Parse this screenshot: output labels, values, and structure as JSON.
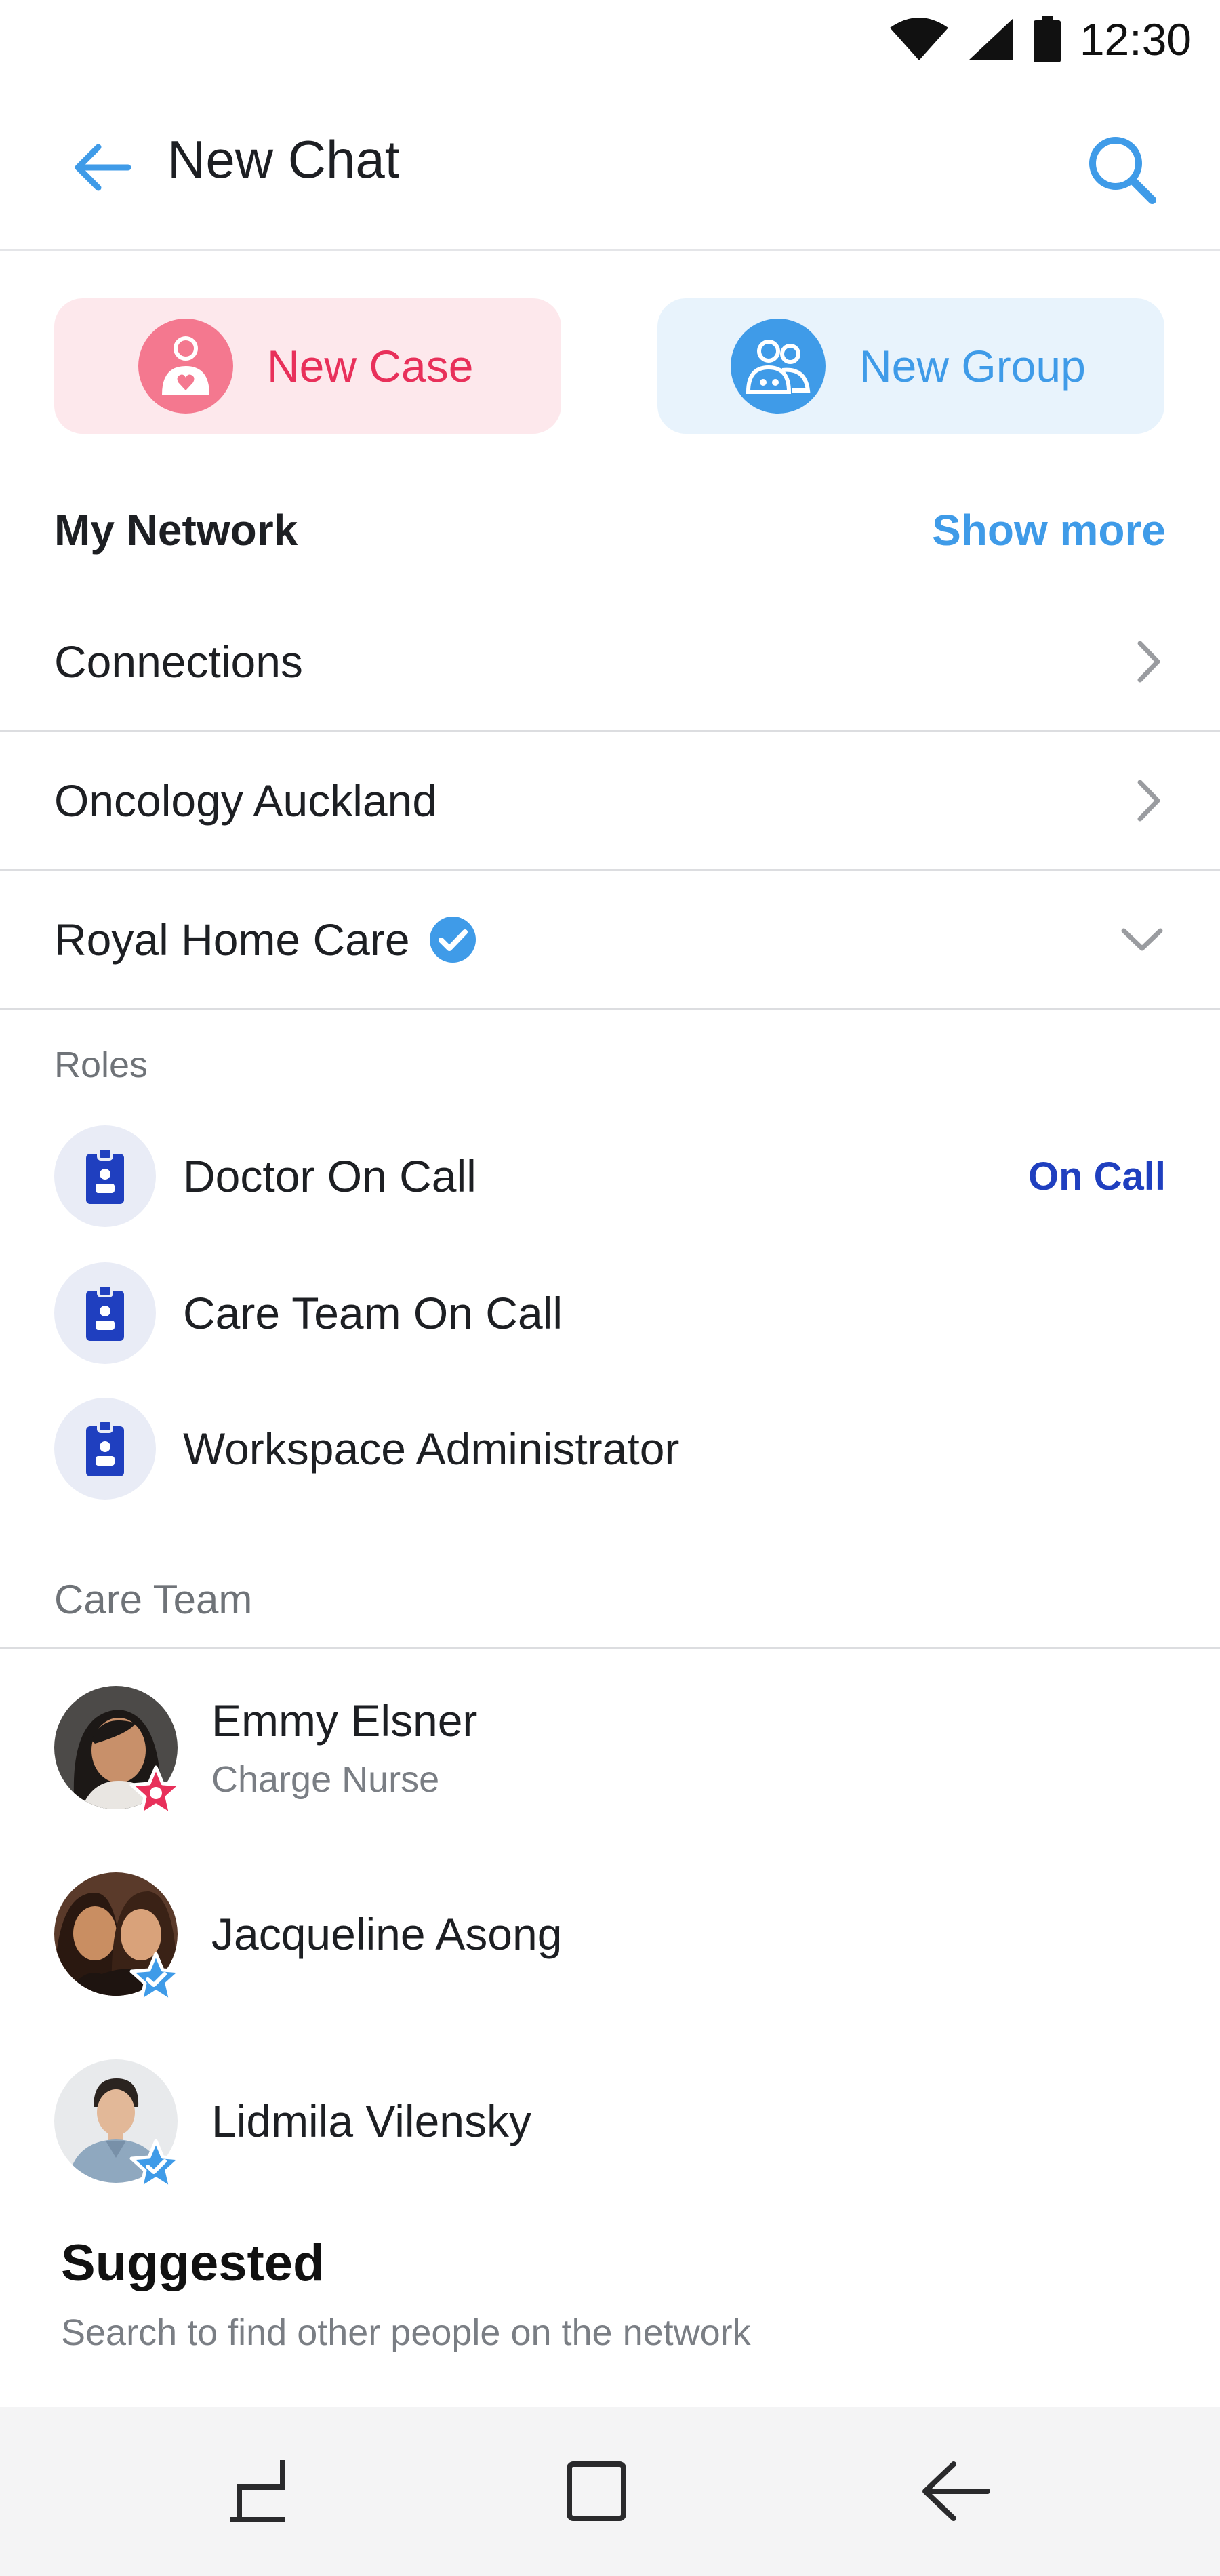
{
  "status_bar": {
    "time": "12:30"
  },
  "app_bar": {
    "title": "New Chat"
  },
  "actions": {
    "new_case": "New Case",
    "new_group": "New Group"
  },
  "my_network": {
    "title": "My Network",
    "show_more": "Show more",
    "items": [
      {
        "label": "Connections"
      },
      {
        "label": "Oncology Auckland"
      },
      {
        "label": "Royal Home Care"
      }
    ]
  },
  "roles": {
    "header": "Roles",
    "items": [
      {
        "label": "Doctor On Call",
        "badge": "On Call"
      },
      {
        "label": "Care Team On Call",
        "badge": ""
      },
      {
        "label": "Workspace Administrator",
        "badge": ""
      }
    ]
  },
  "care_team": {
    "header": "Care Team",
    "members": [
      {
        "name": "Emmy Elsner",
        "subtitle": "Charge Nurse"
      },
      {
        "name": "Jacqueline Asong",
        "subtitle": ""
      },
      {
        "name": "Lidmila Vilensky",
        "subtitle": ""
      }
    ]
  },
  "suggested": {
    "title": "Suggested",
    "subtitle": "Search to find other people on the network"
  },
  "colors": {
    "accent_blue": "#3f9be8",
    "case_pink": "#e8305a",
    "role_blue": "#1f3fbf"
  },
  "icons": [
    "wifi-icon",
    "signal-icon",
    "battery-icon",
    "back-arrow-icon",
    "search-icon",
    "case-person-icon",
    "group-icon",
    "chevron-right-icon",
    "chevron-down-icon",
    "verified-icon",
    "id-badge-icon",
    "star-badge-icon",
    "recents-icon",
    "home-icon",
    "back-icon"
  ]
}
